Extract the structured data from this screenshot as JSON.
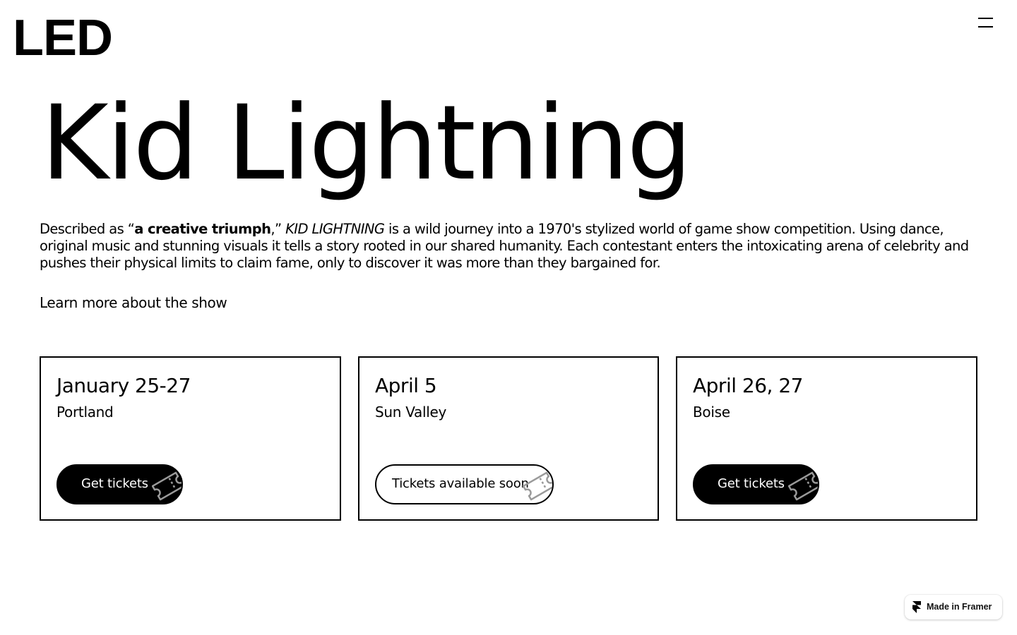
{
  "header": {
    "logo": "LED",
    "menu_icon": "hamburger-menu-icon"
  },
  "hero": {
    "title": "Kid Lightning",
    "description": {
      "part1": "Described as “",
      "quote": "a creative triumph",
      "part2": ",” ",
      "show_name": "KID LIGHTNING",
      "part3": " is a wild journey into a 1970's stylized world of game show competition. Using dance, original music and stunning visuals it tells a story rooted in our shared humanity. Each contestant enters the intoxicating arena of celebrity and pushes their physical limits to claim fame, only to discover it was more than they bargained for."
    },
    "learn_more": "Learn more about the show"
  },
  "shows": [
    {
      "date": "January 25-27",
      "city": "Portland",
      "button_label": "Get tickets",
      "button_style": "solid",
      "icon": "ticket-icon"
    },
    {
      "date": "April 5",
      "city": "Sun Valley",
      "button_label": "Tickets available soon",
      "button_style": "outline",
      "icon": "ticket-icon"
    },
    {
      "date": "April 26, 27",
      "city": "Boise",
      "button_label": "Get tickets",
      "button_style": "solid",
      "icon": "ticket-icon"
    }
  ],
  "badge": {
    "label": "Made in Framer",
    "icon": "framer-logo-icon"
  },
  "colors": {
    "background": "#ffffff",
    "text": "#000000",
    "button_solid": "#000000",
    "button_outline_fill": "#ffffff"
  }
}
